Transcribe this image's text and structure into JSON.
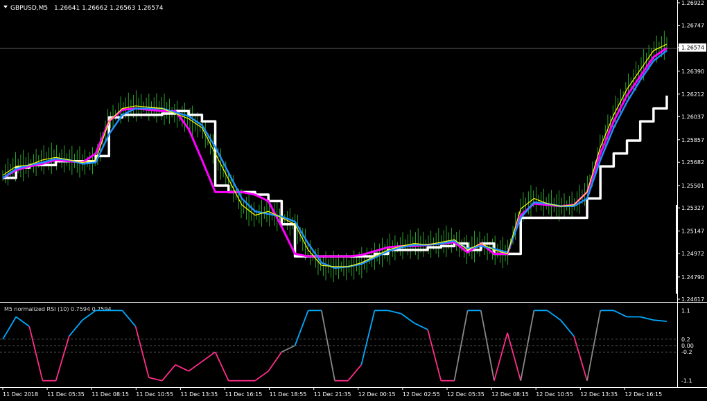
{
  "header": {
    "symbol": "GBPUSD,M5",
    "ohlc": "1.26641 1.26662 1.26563 1.26574"
  },
  "current_price": "1.26574",
  "price_axis": {
    "ticks": [
      "1.26922",
      "1.26747",
      "1.26574",
      "1.26390",
      "1.26212",
      "1.26037",
      "1.25857",
      "1.25682",
      "1.25501",
      "1.25327",
      "1.25147",
      "1.24972",
      "1.24790",
      "1.24617"
    ],
    "range": [
      1.24617,
      1.26922
    ]
  },
  "indicator": {
    "title": "M5 normalized RSI (10) 0.7594 0.7594",
    "ticks": [
      "1.1",
      "0.2",
      "0.00",
      "-0.2",
      "-1.1"
    ],
    "range": [
      -1.15,
      1.15
    ]
  },
  "time_axis": {
    "labels": [
      "11 Dec 2018",
      "11 Dec 05:35",
      "11 Dec 08:15",
      "11 Dec 10:55",
      "11 Dec 13:35",
      "11 Dec 16:15",
      "11 Dec 18:55",
      "11 Dec 21:35",
      "12 Dec 00:15",
      "12 Dec 02:55",
      "12 Dec 05:35",
      "12 Dec 08:15",
      "12 Dec 10:55",
      "12 Dec 13:35",
      "12 Dec 16:15"
    ]
  },
  "colors": {
    "background": "#000000",
    "price_line": "#ffffff",
    "bars": "#33cc33",
    "yellow_ma": "#ffff00",
    "blue_ma": "#1e90ff",
    "pink_ma": "#ff00ff",
    "white_step": "#ffffff",
    "rsi_up": "#00aaff",
    "rsi_down": "#ff2d8a",
    "rsi_mid": "#888888"
  },
  "chart_data": [
    {
      "type": "line",
      "title": "GBPUSD,M5",
      "xlabel": "",
      "ylabel": "",
      "ylim": [
        1.24617,
        1.26922
      ],
      "x_labels": [
        "11 Dec 2018",
        "11 Dec 05:35",
        "11 Dec 08:15",
        "11 Dec 10:55",
        "11 Dec 13:35",
        "11 Dec 16:15",
        "11 Dec 18:55",
        "11 Dec 21:35",
        "12 Dec 00:15",
        "12 Dec 02:55",
        "12 Dec 05:35",
        "12 Dec 08:15",
        "12 Dec 10:55",
        "12 Dec 13:35",
        "12 Dec 16:15"
      ],
      "series": [
        {
          "values": [
            1.2558,
            1.2565,
            1.2566,
            1.257,
            1.2572,
            1.257,
            1.2568,
            1.257,
            1.26,
            1.261,
            1.2612,
            1.2611,
            1.261,
            1.2606,
            1.2602,
            1.2595,
            1.2575,
            1.2555,
            1.2535,
            1.2527,
            1.253,
            1.2525,
            1.252,
            1.25,
            1.2488,
            1.2487,
            1.2487,
            1.249,
            1.2495,
            1.25,
            1.2503,
            1.2505,
            1.2504,
            1.2506,
            1.2508,
            1.25,
            1.2505,
            1.25,
            1.2497,
            1.2532,
            1.254,
            1.2536,
            1.2534,
            1.2535,
            1.2545,
            1.258,
            1.2605,
            1.2625,
            1.264,
            1.2655,
            1.266
          ]
        },
        {
          "values": [
            1.2556,
            1.2563,
            1.2566,
            1.2568,
            1.2571,
            1.257,
            1.2567,
            1.2568,
            1.259,
            1.2605,
            1.261,
            1.261,
            1.261,
            1.2607,
            1.2604,
            1.2597,
            1.258,
            1.256,
            1.254,
            1.253,
            1.2528,
            1.2526,
            1.2522,
            1.2505,
            1.249,
            1.2486,
            1.2487,
            1.2489,
            1.2494,
            1.2499,
            1.2502,
            1.2504,
            1.2504,
            1.2505,
            1.2507,
            1.2501,
            1.2503,
            1.2501,
            1.2498,
            1.2525,
            1.2537,
            1.2536,
            1.2534,
            1.2534,
            1.254,
            1.257,
            1.2595,
            1.2615,
            1.2632,
            1.2647,
            1.2655
          ]
        },
        {
          "values": [
            1.2556,
            1.2562,
            1.2565,
            1.2567,
            1.257,
            1.2569,
            1.2568,
            1.2575,
            1.26,
            1.2609,
            1.261,
            1.2609,
            1.2608,
            1.2608,
            1.2594,
            1.257,
            1.2545,
            1.2545,
            1.2545,
            1.2543,
            1.2538,
            1.2518,
            1.2497,
            1.2495,
            1.2495,
            1.2495,
            1.2495,
            1.2496,
            1.2499,
            1.2502,
            1.2503,
            1.2503,
            1.2504,
            1.2505,
            1.2506,
            1.2498,
            1.2505,
            1.2497,
            1.2497,
            1.2527,
            1.2536,
            1.2535,
            1.2534,
            1.2535,
            1.2545,
            1.2575,
            1.26,
            1.262,
            1.2635,
            1.265,
            1.2657
          ]
        },
        {
          "values": [
            1.2556,
            1.2564,
            1.2566,
            1.2566,
            1.2569,
            1.2569,
            1.2569,
            1.2573,
            1.2603,
            1.2605,
            1.2605,
            1.2605,
            1.2606,
            1.2608,
            1.2605,
            1.26,
            1.255,
            1.2545,
            1.2545,
            1.2543,
            1.2538,
            1.252,
            1.2495,
            1.2495,
            1.2495,
            1.2495,
            1.2495,
            1.2495,
            1.2497,
            1.25,
            1.25,
            1.25,
            1.2502,
            1.2503,
            1.2505,
            1.25,
            1.2505,
            1.2497,
            1.2497,
            1.2525,
            1.2525,
            1.2525,
            1.2525,
            1.2525,
            1.254,
            1.2565,
            1.2575,
            1.2585,
            1.26,
            1.261,
            1.262
          ]
        }
      ]
    },
    {
      "type": "line",
      "title": "M5 normalized RSI (10) 0.7594 0.7594",
      "ylim": [
        -1.15,
        1.15
      ],
      "series": [
        {
          "values": [
            0.2,
            0.9,
            0.6,
            -1.1,
            -1.1,
            0.3,
            0.8,
            1.1,
            1.1,
            1.1,
            0.6,
            -1.0,
            -1.1,
            -0.6,
            -0.8,
            -0.5,
            -0.2,
            -1.1,
            -1.1,
            -1.1,
            -0.8,
            -0.2,
            0.0,
            1.1,
            1.1,
            -1.1,
            -1.1,
            -0.6,
            1.1,
            1.1,
            1.0,
            0.7,
            0.5,
            -1.1,
            -1.1,
            1.1,
            1.1,
            -1.1,
            0.4,
            -1.1,
            1.1,
            1.1,
            0.8,
            0.3,
            -1.1,
            1.1,
            1.1,
            0.9,
            0.9,
            0.8,
            0.76
          ]
        }
      ]
    }
  ]
}
